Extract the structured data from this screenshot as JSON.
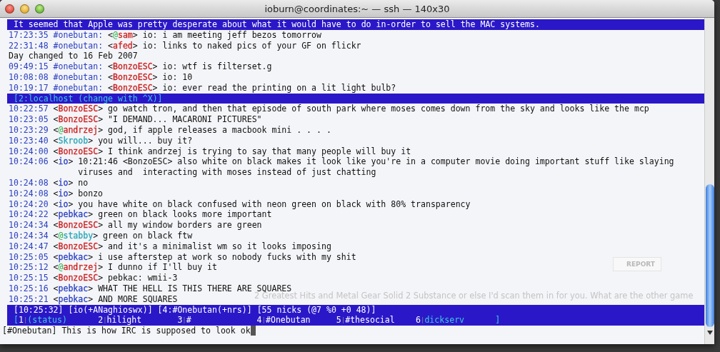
{
  "window": {
    "title": "ioburn@coordinates:~ — ssh — 140x30"
  },
  "background_page": {
    "report_button": "REPORT",
    "faint_text": "2 Greatest Hits and Metal Gear Solid 2 Substance or else I'd scan them in for you. What are the other game"
  },
  "lines": [
    {
      "kind": "topic",
      "text": "It seemed that Apple was pretty desperate about what it would have to do in-order to sell the MAC systems."
    },
    {
      "kind": "message",
      "time": "17:23:35",
      "channel": "#onebutan:",
      "mode": "@",
      "nick": "sam",
      "color": "#cc2222",
      "text_lines": [
        "io: i am meeting jeff bezos tomorrow"
      ]
    },
    {
      "kind": "message",
      "time": "22:31:48",
      "channel": "#onebutan:",
      "nick": "afed",
      "color": "#cc2222",
      "text_lines": [
        "io: links to naked pics of your GF on flickr"
      ]
    },
    {
      "kind": "info",
      "text": "Day changed to 16 Feb 2007"
    },
    {
      "kind": "message",
      "time": "09:49:15",
      "channel": "#onebutan:",
      "nick": "BonzoESC",
      "color": "#cc2222",
      "text_lines": [
        "io: wtf is filterset.g"
      ]
    },
    {
      "kind": "message",
      "time": "10:08:08",
      "channel": "#onebutan:",
      "nick": "BonzoESC",
      "color": "#cc2222",
      "text_lines": [
        "io: 10"
      ]
    },
    {
      "kind": "message",
      "time": "10:19:17",
      "channel": "#onebutan:",
      "nick": "BonzoESC",
      "color": "#cc2222",
      "text_lines": [
        "io: ever read the printing on a lit light bulb?"
      ]
    },
    {
      "kind": "window_bar",
      "text": "[2:localhost (change with ^X)]"
    },
    {
      "kind": "message",
      "time": "10:22:57",
      "nick": "BonzoESC",
      "color": "#cc2222",
      "text_lines": [
        "go watch tron, and then that episode of south park where moses comes down from the sky and looks like the mcp"
      ]
    },
    {
      "kind": "message",
      "time": "10:23:05",
      "nick": "BonzoESC",
      "color": "#cc2222",
      "text_lines": [
        "\"I DEMAND... MACARONI PICTURES\""
      ]
    },
    {
      "kind": "message",
      "time": "10:23:29",
      "mode": "@",
      "nick": "andrzej",
      "color": "#cc2222",
      "text_lines": [
        "god, if apple releases a macbook mini . . . ."
      ]
    },
    {
      "kind": "message",
      "time": "10:23:40",
      "nick": "Skroob",
      "color": "#2aa6b8",
      "text_lines": [
        "you will... buy it?"
      ]
    },
    {
      "kind": "message",
      "time": "10:24:00",
      "nick": "BonzoESC",
      "color": "#cc2222",
      "text_lines": [
        "I think andrzej is trying to say that many people will buy it"
      ]
    },
    {
      "kind": "message",
      "time": "10:24:06",
      "nick": "io",
      "color": "#2a3fc0",
      "text_lines": [
        "10:21:46 <BonzoESC> also white on black makes it look like you're in a computer movie doing important stuff like slaying",
        "viruses and  interacting with moses instead of just chatting"
      ]
    },
    {
      "kind": "message",
      "time": "10:24:08",
      "nick": "io",
      "color": "#2a3fc0",
      "text_lines": [
        "no"
      ]
    },
    {
      "kind": "message",
      "time": "10:24:08",
      "nick": "io",
      "color": "#2a3fc0",
      "text_lines": [
        "bonzo"
      ]
    },
    {
      "kind": "message",
      "time": "10:24:20",
      "nick": "io",
      "color": "#2a3fc0",
      "text_lines": [
        "you have white on black confused with neon green on black with 80% transparency"
      ]
    },
    {
      "kind": "message",
      "time": "10:24:22",
      "nick": "pebkac",
      "color": "#2a3fc0",
      "text_lines": [
        "green on black looks more important"
      ]
    },
    {
      "kind": "message",
      "time": "10:24:34",
      "nick": "BonzoESC",
      "color": "#cc2222",
      "text_lines": [
        "all my window borders are green"
      ]
    },
    {
      "kind": "message",
      "time": "10:24:34",
      "mode": "@",
      "nick": "stabby",
      "color": "#2aa6b8",
      "text_lines": [
        "green on black ftw"
      ]
    },
    {
      "kind": "message",
      "time": "10:24:47",
      "nick": "BonzoESC",
      "color": "#cc2222",
      "text_lines": [
        "and it's a minimalist wm so it looks imposing"
      ]
    },
    {
      "kind": "message",
      "time": "10:25:05",
      "nick": "pebkac",
      "color": "#2a3fc0",
      "text_lines": [
        "i use afterstep at work so nobody fucks with my shit"
      ]
    },
    {
      "kind": "message",
      "time": "10:25:12",
      "mode": "@",
      "nick": "andrzej",
      "color": "#cc2222",
      "text_lines": [
        "I dunno if I'll buy it"
      ]
    },
    {
      "kind": "message",
      "time": "10:25:15",
      "nick": "BonzoESC",
      "color": "#cc2222",
      "text_lines": [
        "pebkac: wmii-3"
      ]
    },
    {
      "kind": "message",
      "time": "10:25:16",
      "nick": "pebkac",
      "color": "#2a3fc0",
      "text_lines": [
        "WHAT THE HELL IS THIS THERE ARE SQUARES"
      ]
    },
    {
      "kind": "message",
      "time": "10:25:21",
      "nick": "pebkac",
      "color": "#2a3fc0",
      "text_lines": [
        "AND MORE SQUARES"
      ]
    }
  ],
  "nick_brackets": {
    "open": "<",
    "close": ">"
  },
  "status_bar": {
    "items": [
      "[10:25:32]",
      "[io(+ANaghioswx)]",
      "[4:#Onebutan(+nrs)]",
      "[55 nicks (@7 %0 +0 48)]"
    ]
  },
  "window_list": {
    "open": "[",
    "close": "]",
    "separator": "|",
    "items": [
      {
        "number": "1",
        "name": "(status)",
        "color": "#40c8e0"
      },
      {
        "number": "2",
        "name": "hilight",
        "color": "#ffffff"
      },
      {
        "number": "3",
        "name": "#",
        "color": "#ffffff"
      },
      {
        "number": "4",
        "name": "#Onebutan",
        "color": "#ffffff"
      },
      {
        "number": "5",
        "name": "#thesocial",
        "color": "#ffffff"
      },
      {
        "number": "6",
        "name": "dickserv",
        "color": "#40c8e0"
      }
    ]
  },
  "input": {
    "prompt": "[#Onebutan]",
    "value": "This is how IRC is supposed to look ok"
  }
}
